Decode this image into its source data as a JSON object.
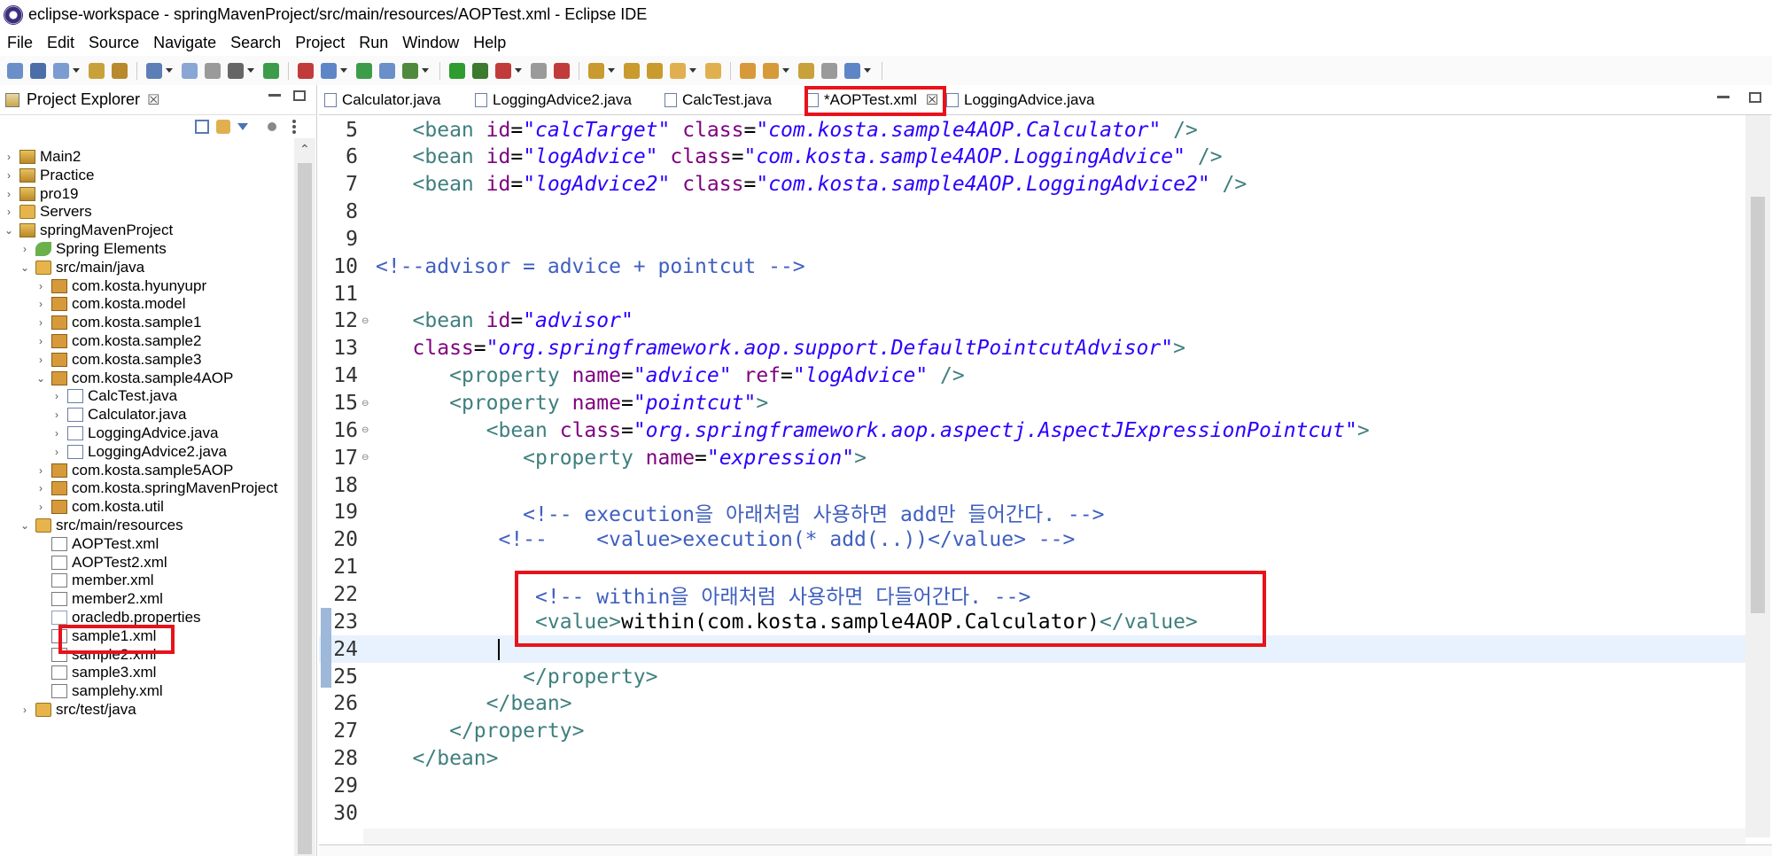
{
  "window": {
    "title": "eclipse-workspace - springMavenProject/src/main/resources/AOPTest.xml - Eclipse IDE"
  },
  "menu": [
    "File",
    "Edit",
    "Source",
    "Navigate",
    "Search",
    "Project",
    "Run",
    "Window",
    "Help"
  ],
  "project_explorer": {
    "title": "Project Explorer",
    "close_glyph": "☒",
    "tree": [
      {
        "label": "Main2",
        "icon": "project-icon",
        "depth": 0,
        "expanded": false
      },
      {
        "label": "Practice",
        "icon": "project-icon",
        "depth": 0,
        "expanded": false
      },
      {
        "label": "pro19",
        "icon": "project-icon",
        "depth": 0,
        "expanded": false
      },
      {
        "label": "Servers",
        "icon": "folder-icon",
        "depth": 0,
        "expanded": false
      },
      {
        "label": "springMavenProject",
        "icon": "project-icon",
        "depth": 0,
        "expanded": true
      },
      {
        "label": "Spring Elements",
        "icon": "spring-icon",
        "depth": 1,
        "expanded": false
      },
      {
        "label": "src/main/java",
        "icon": "folder-icon",
        "depth": 1,
        "expanded": true
      },
      {
        "label": "com.kosta.hyunyupr",
        "icon": "package-icon",
        "depth": 2,
        "expanded": false
      },
      {
        "label": "com.kosta.model",
        "icon": "package-icon",
        "depth": 2,
        "expanded": false
      },
      {
        "label": "com.kosta.sample1",
        "icon": "package-icon",
        "depth": 2,
        "expanded": false
      },
      {
        "label": "com.kosta.sample2",
        "icon": "package-icon",
        "depth": 2,
        "expanded": false
      },
      {
        "label": "com.kosta.sample3",
        "icon": "package-icon",
        "depth": 2,
        "expanded": false
      },
      {
        "label": "com.kosta.sample4AOP",
        "icon": "package-icon",
        "depth": 2,
        "expanded": true
      },
      {
        "label": "CalcTest.java",
        "icon": "java-file-icon",
        "depth": 3,
        "expanded": false
      },
      {
        "label": "Calculator.java",
        "icon": "java-file-icon",
        "depth": 3,
        "expanded": false
      },
      {
        "label": "LoggingAdvice.java",
        "icon": "java-file-icon",
        "depth": 3,
        "expanded": false
      },
      {
        "label": "LoggingAdvice2.java",
        "icon": "java-file-icon",
        "depth": 3,
        "expanded": false
      },
      {
        "label": "com.kosta.sample5AOP",
        "icon": "package-icon",
        "depth": 2,
        "expanded": false
      },
      {
        "label": "com.kosta.springMavenProject",
        "icon": "package-icon",
        "depth": 2,
        "expanded": false
      },
      {
        "label": "com.kosta.util",
        "icon": "package-icon",
        "depth": 2,
        "expanded": false
      },
      {
        "label": "src/main/resources",
        "icon": "folder-icon",
        "depth": 1,
        "expanded": true
      },
      {
        "label": "AOPTest.xml",
        "icon": "xml-file-icon",
        "depth": 2,
        "leaf": true
      },
      {
        "label": "AOPTest2.xml",
        "icon": "xml-file-icon",
        "depth": 2,
        "leaf": true
      },
      {
        "label": "member.xml",
        "icon": "xml-file-icon",
        "depth": 2,
        "leaf": true
      },
      {
        "label": "member2.xml",
        "icon": "xml-file-icon",
        "depth": 2,
        "leaf": true
      },
      {
        "label": "oracledb.properties",
        "icon": "properties-file-icon",
        "depth": 2,
        "leaf": true
      },
      {
        "label": "sample1.xml",
        "icon": "xml-file-icon",
        "depth": 2,
        "leaf": true
      },
      {
        "label": "sample2.xml",
        "icon": "xml-file-icon",
        "depth": 2,
        "leaf": true
      },
      {
        "label": "sample3.xml",
        "icon": "xml-file-icon",
        "depth": 2,
        "leaf": true
      },
      {
        "label": "samplehy.xml",
        "icon": "xml-file-icon",
        "depth": 2,
        "leaf": true
      },
      {
        "label": "src/test/java",
        "icon": "folder-icon",
        "depth": 1,
        "expanded": false
      }
    ]
  },
  "editor_tabs": [
    {
      "label": "Calculator.java",
      "active": false
    },
    {
      "label": "LoggingAdvice2.java",
      "active": false
    },
    {
      "label": "CalcTest.java",
      "active": false
    },
    {
      "label": "*AOPTest.xml",
      "active": true,
      "close": "☒"
    },
    {
      "label": "LoggingAdvice.java",
      "active": false
    }
  ],
  "code_lines": [
    {
      "n": "5",
      "indent": "   ",
      "parts": [
        [
          "tag",
          "<bean "
        ],
        [
          "attr",
          "id"
        ],
        [
          "text",
          "="
        ],
        [
          "str",
          "\"calcTarget\""
        ],
        [
          "text",
          " "
        ],
        [
          "attr",
          "class"
        ],
        [
          "text",
          "="
        ],
        [
          "str",
          "\"com.kosta.sample4AOP.Calculator\""
        ],
        [
          "tag",
          " />"
        ]
      ]
    },
    {
      "n": "6",
      "indent": "   ",
      "parts": [
        [
          "tag",
          "<bean "
        ],
        [
          "attr",
          "id"
        ],
        [
          "text",
          "="
        ],
        [
          "str",
          "\"logAdvice\""
        ],
        [
          "text",
          " "
        ],
        [
          "attr",
          "class"
        ],
        [
          "text",
          "="
        ],
        [
          "str",
          "\"com.kosta.sample4AOP.LoggingAdvice\""
        ],
        [
          "tag",
          " />"
        ]
      ]
    },
    {
      "n": "7",
      "indent": "   ",
      "parts": [
        [
          "tag",
          "<bean "
        ],
        [
          "attr",
          "id"
        ],
        [
          "text",
          "="
        ],
        [
          "str",
          "\"logAdvice2\""
        ],
        [
          "text",
          " "
        ],
        [
          "attr",
          "class"
        ],
        [
          "text",
          "="
        ],
        [
          "str",
          "\"com.kosta.sample4AOP.LoggingAdvice2\""
        ],
        [
          "tag",
          " />"
        ]
      ]
    },
    {
      "n": "8",
      "indent": "",
      "parts": []
    },
    {
      "n": "9",
      "indent": "",
      "parts": []
    },
    {
      "n": "10",
      "indent": "",
      "parts": [
        [
          "comment",
          "<!--advisor = advice + pointcut -->"
        ]
      ]
    },
    {
      "n": "11",
      "indent": "",
      "parts": []
    },
    {
      "n": "12",
      "indent": "   ",
      "fold": true,
      "parts": [
        [
          "tag",
          "<bean "
        ],
        [
          "attr",
          "id"
        ],
        [
          "text",
          "="
        ],
        [
          "str",
          "\"advisor\""
        ]
      ]
    },
    {
      "n": "13",
      "indent": "   ",
      "parts": [
        [
          "attr",
          "class"
        ],
        [
          "text",
          "="
        ],
        [
          "str",
          "\"org.springframework.aop.support.DefaultPointcutAdvisor\""
        ],
        [
          "tag",
          ">"
        ]
      ]
    },
    {
      "n": "14",
      "indent": "      ",
      "parts": [
        [
          "tag",
          "<property "
        ],
        [
          "attr",
          "name"
        ],
        [
          "text",
          "="
        ],
        [
          "str",
          "\"advice\""
        ],
        [
          "text",
          " "
        ],
        [
          "attr",
          "ref"
        ],
        [
          "text",
          "="
        ],
        [
          "str",
          "\"logAdvice\""
        ],
        [
          "tag",
          " />"
        ]
      ]
    },
    {
      "n": "15",
      "indent": "      ",
      "fold": true,
      "parts": [
        [
          "tag",
          "<property "
        ],
        [
          "attr",
          "name"
        ],
        [
          "text",
          "="
        ],
        [
          "str",
          "\"pointcut\""
        ],
        [
          "tag",
          ">"
        ]
      ]
    },
    {
      "n": "16",
      "indent": "         ",
      "fold": true,
      "parts": [
        [
          "tag",
          "<bean "
        ],
        [
          "attr",
          "class"
        ],
        [
          "text",
          "="
        ],
        [
          "str",
          "\"org.springframework.aop.aspectj.AspectJExpressionPointcut\""
        ],
        [
          "tag",
          ">"
        ]
      ]
    },
    {
      "n": "17",
      "indent": "            ",
      "fold": true,
      "parts": [
        [
          "tag",
          "<property "
        ],
        [
          "attr",
          "name"
        ],
        [
          "text",
          "="
        ],
        [
          "str",
          "\"expression\""
        ],
        [
          "tag",
          ">"
        ]
      ]
    },
    {
      "n": "18",
      "indent": "",
      "parts": []
    },
    {
      "n": "19",
      "indent": "            ",
      "parts": [
        [
          "comment",
          "<!-- execution을 아래처럼 사용하면 add만 들어간다. -->"
        ]
      ]
    },
    {
      "n": "20",
      "indent": "          ",
      "parts": [
        [
          "comment",
          "<!--    <value>execution(* add(..))</value> -->"
        ]
      ]
    },
    {
      "n": "21",
      "indent": "",
      "parts": []
    },
    {
      "n": "22",
      "indent": "             ",
      "parts": [
        [
          "comment",
          "<!-- within을 아래처럼 사용하면 다들어간다. -->"
        ]
      ]
    },
    {
      "n": "23",
      "indent": "             ",
      "parts": [
        [
          "tag",
          "<value>"
        ],
        [
          "text",
          "within(com.kosta.sample4AOP.Calculator)"
        ],
        [
          "tag",
          "</value>"
        ]
      ]
    },
    {
      "n": "24",
      "indent": "          ",
      "current": true,
      "parts": []
    },
    {
      "n": "25",
      "indent": "            ",
      "parts": [
        [
          "tag",
          "</property>"
        ]
      ]
    },
    {
      "n": "26",
      "indent": "         ",
      "parts": [
        [
          "tag",
          "</bean>"
        ]
      ]
    },
    {
      "n": "27",
      "indent": "      ",
      "parts": [
        [
          "tag",
          "</property>"
        ]
      ]
    },
    {
      "n": "28",
      "indent": "   ",
      "parts": [
        [
          "tag",
          "</bean>"
        ]
      ]
    },
    {
      "n": "29",
      "indent": "",
      "parts": []
    },
    {
      "n": "30",
      "indent": "",
      "parts": []
    }
  ],
  "colors": {
    "highlight": "#e8121b",
    "tag": "#3f7f7f",
    "attr": "#7f007f",
    "string": "#2a00ff",
    "comment": "#3f5fbf",
    "current_line": "#e8f2fe"
  }
}
